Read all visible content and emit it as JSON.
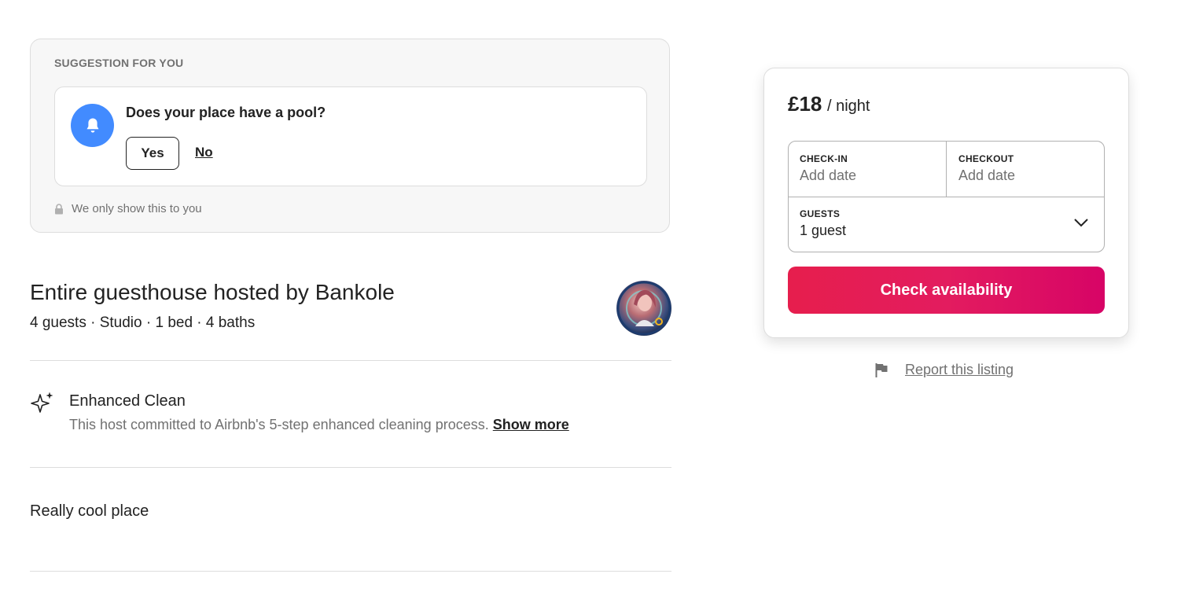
{
  "suggestion": {
    "heading": "SUGGESTION FOR YOU",
    "question": "Does your place have a pool?",
    "yes_label": "Yes",
    "no_label": "No",
    "privacy_note": "We only show this to you",
    "accent_color": "#428bff"
  },
  "listing": {
    "title": "Entire guesthouse hosted by Bankole",
    "subtitle": "4 guests · Studio · 1 bed · 4 baths",
    "feature": {
      "title": "Enhanced Clean",
      "description": "This host committed to Airbnb's 5-step enhanced cleaning process.",
      "show_more": "Show more"
    },
    "description": "Really cool place"
  },
  "booking": {
    "price": "£18",
    "per_night": "/ night",
    "checkin_label": "CHECK-IN",
    "checkin_value": "Add date",
    "checkout_label": "CHECKOUT",
    "checkout_value": "Add date",
    "guests_label": "GUESTS",
    "guests_value": "1 guest",
    "cta": "Check availability",
    "cta_color": "#e31c5f"
  },
  "report": {
    "label": "Report this listing"
  }
}
